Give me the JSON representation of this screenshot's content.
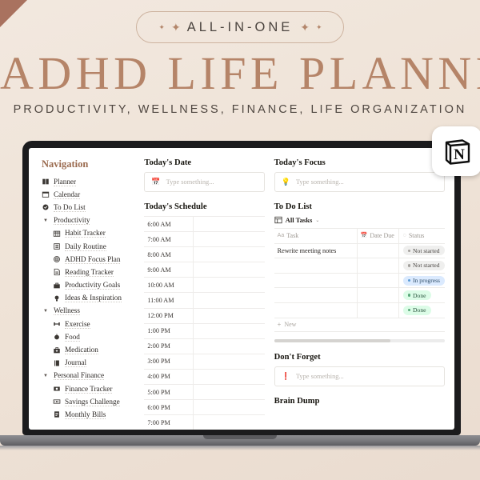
{
  "header": {
    "badge_text": "ALL-IN-ONE",
    "sparkle_icon": "✦",
    "title": "ADHD LIFE PLANNER",
    "subtitle": "PRODUCTIVITY, WELLNESS, FINANCE, LIFE ORGANIZATION",
    "brand_logo": "N",
    "colors": {
      "title": "#b58468",
      "badge_border": "#cdb39f",
      "corner": "#a9725f"
    }
  },
  "sidebar": {
    "title": "Navigation",
    "items": [
      {
        "label": "Planner",
        "icon": "book-icon",
        "level": "top"
      },
      {
        "label": "Calendar",
        "icon": "calendar-icon",
        "level": "top"
      },
      {
        "label": "To Do List",
        "icon": "check-circle-icon",
        "level": "top"
      },
      {
        "label": "Productivity",
        "icon": "caret-down-icon",
        "level": "group"
      },
      {
        "label": "Habit Tracker",
        "icon": "grid-icon",
        "level": "child"
      },
      {
        "label": "Daily Routine",
        "icon": "list-icon",
        "level": "child"
      },
      {
        "label": "ADHD Focus Plan",
        "icon": "target-icon",
        "level": "child"
      },
      {
        "label": "Reading Tracker",
        "icon": "document-icon",
        "level": "child"
      },
      {
        "label": "Productivity Goals",
        "icon": "briefcase-icon",
        "level": "child"
      },
      {
        "label": "Ideas & Inspiration",
        "icon": "lightbulb-icon",
        "level": "child"
      },
      {
        "label": "Wellness",
        "icon": "caret-down-icon",
        "level": "group"
      },
      {
        "label": "Exercise",
        "icon": "dumbbell-icon",
        "level": "child"
      },
      {
        "label": "Food",
        "icon": "apple-icon",
        "level": "child"
      },
      {
        "label": "Medication",
        "icon": "medkit-icon",
        "level": "child"
      },
      {
        "label": "Journal",
        "icon": "notebook-icon",
        "level": "child"
      },
      {
        "label": "Personal Finance",
        "icon": "caret-down-icon",
        "level": "group"
      },
      {
        "label": "Finance Tracker",
        "icon": "money-icon",
        "level": "child"
      },
      {
        "label": "Savings Challenge",
        "icon": "cash-icon",
        "level": "child"
      },
      {
        "label": "Monthly Bills",
        "icon": "receipt-icon",
        "level": "child"
      }
    ]
  },
  "middle": {
    "date_heading": "Today's Date",
    "date_placeholder": "Type something...",
    "date_icon": "📅",
    "schedule_heading": "Today's Schedule",
    "schedule_times": [
      "6:00 AM",
      "7:00 AM",
      "8:00 AM",
      "9:00 AM",
      "10:00 AM",
      "11:00 AM",
      "12:00 PM",
      "1:00 PM",
      "2:00 PM",
      "3:00 PM",
      "4:00 PM",
      "5:00 PM",
      "6:00 PM",
      "7:00 PM"
    ]
  },
  "right": {
    "focus_heading": "Today's Focus",
    "focus_placeholder": "Type something...",
    "focus_icon": "💡",
    "todo_heading": "To Do List",
    "view_name": "All Tasks",
    "view_icon": "table-icon",
    "chevron": "⌄",
    "columns": [
      {
        "label": "Task",
        "icon": "Aa"
      },
      {
        "label": "Date Due",
        "icon": "📅"
      },
      {
        "label": "Status",
        "icon": "◌"
      }
    ],
    "rows": [
      {
        "task": "Rewrite meeting notes",
        "date": "",
        "status": "Not started",
        "status_color": "gray"
      },
      {
        "task": "",
        "date": "",
        "status": "Not started",
        "status_color": "gray"
      },
      {
        "task": "",
        "date": "",
        "status": "In progress",
        "status_color": "blue"
      },
      {
        "task": "",
        "date": "",
        "status": "Done",
        "status_color": "green"
      },
      {
        "task": "",
        "date": "",
        "status": "Done",
        "status_color": "green"
      }
    ],
    "new_row_label": "New",
    "new_row_icon": "+",
    "dont_forget_heading": "Don't Forget",
    "dont_forget_placeholder": "Type something...",
    "dont_forget_icon": "❗",
    "brain_dump_heading": "Brain Dump",
    "status_colors": {
      "gray": {
        "bg": "#efefee",
        "dot": "#a3a09c",
        "text": "#4a4643"
      },
      "blue": {
        "bg": "#dbeafe",
        "dot": "#5b9bd5",
        "text": "#2b4a66"
      },
      "green": {
        "bg": "#dcfce7",
        "dot": "#5aa87a",
        "text": "#2c5740"
      }
    }
  }
}
